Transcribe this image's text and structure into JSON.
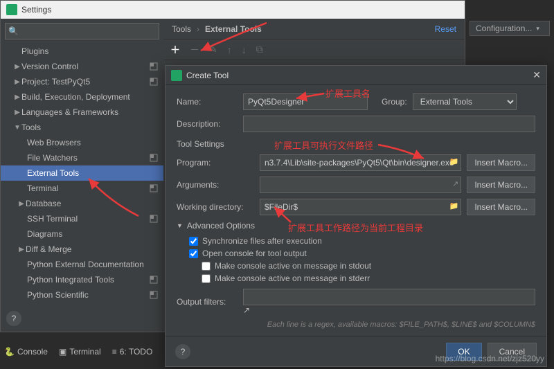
{
  "settings_title": "Settings",
  "search_placeholder": "",
  "tree": {
    "plugins": "Plugins",
    "version_control": "Version Control",
    "project": "Project: TestPyQt5",
    "build": "Build, Execution, Deployment",
    "languages": "Languages & Frameworks",
    "tools": "Tools",
    "web_browsers": "Web Browsers",
    "file_watchers": "File Watchers",
    "external_tools": "External Tools",
    "terminal": "Terminal",
    "database": "Database",
    "ssh_terminal": "SSH Terminal",
    "diagrams": "Diagrams",
    "diff_merge": "Diff & Merge",
    "py_ext_doc": "Python External Documentation",
    "py_int_tools": "Python Integrated Tools",
    "py_sci": "Python Scientific"
  },
  "breadcrumb": {
    "root": "Tools",
    "leaf": "External Tools",
    "reset": "Reset"
  },
  "topright": {
    "configuration": "Configuration..."
  },
  "dialog": {
    "title": "Create Tool",
    "name_label": "Name:",
    "name_value": "PyQt5Designer",
    "group_label": "Group:",
    "group_value": "External Tools",
    "desc_label": "Description:",
    "desc_value": "",
    "section": "Tool Settings",
    "program_label": "Program:",
    "program_value": "n3.7.4\\Lib\\site-packages\\PyQt5\\Qt\\bin\\designer.exe",
    "arguments_label": "Arguments:",
    "arguments_value": "",
    "workdir_label": "Working directory:",
    "workdir_value": "$FileDir$",
    "macro_btn": "Insert Macro...",
    "adv_label": "Advanced Options",
    "sync": "Synchronize files after execution",
    "open_console": "Open console for tool output",
    "console_stdout": "Make console active on message in stdout",
    "console_stderr": "Make console active on message in stderr",
    "filters_label": "Output filters:",
    "filters_hint": "Each line is a regex, available macros: $FILE_PATH$, $LINE$ and $COLUMN$",
    "ok": "OK",
    "cancel": "Cancel"
  },
  "bottom": {
    "console": "Console",
    "terminal": "Terminal",
    "todo": "6: TODO"
  },
  "annotations": {
    "tool_name": "扩展工具名",
    "exe_path": "扩展工具可执行文件路径",
    "work_dir": "扩展工具工作路径为当前工程目录"
  },
  "watermark": "https://blog.csdn.net/zjz520yy"
}
